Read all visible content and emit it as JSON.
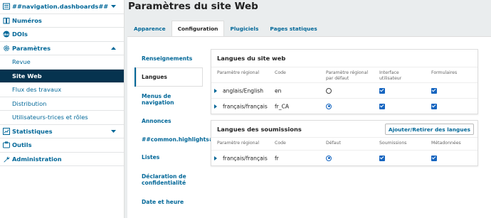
{
  "sidebar": {
    "dashboards": "##navigation.dashboards##",
    "numeros": "Numéros",
    "dois": "DOIs",
    "parametres": "Paramètres",
    "sub_items": [
      "Revue",
      "Site Web",
      "Flux des travaux",
      "Distribution",
      "Utilisateurs-trices et rôles"
    ],
    "statistiques": "Statistiques",
    "outils": "Outils",
    "administration": "Administration",
    "active_item": "Site Web"
  },
  "page": {
    "title": "Paramètres du site Web"
  },
  "tabs": [
    "Apparence",
    "Configuration",
    "Plugiciels",
    "Pages statiques"
  ],
  "active_tab": "Configuration",
  "subnav": [
    "Renseignements",
    "Langues",
    "Menus de navigation",
    "Annonces",
    "##common.highlights##",
    "Listes",
    "Déclaration de confidentialité",
    "Date et heure"
  ],
  "active_subnav": "Langues",
  "site_languages": {
    "title": "Langues du site web",
    "headers": [
      "Paramètre régional",
      "Code",
      "Paramètre régional par défaut",
      "Interface utilisateur",
      "Formulaires"
    ],
    "rows": [
      {
        "locale": "anglais/English",
        "code": "en",
        "default": false,
        "ui": true,
        "forms": true
      },
      {
        "locale": "français/français",
        "code": "fr_CA",
        "default": true,
        "ui": true,
        "forms": true
      }
    ]
  },
  "submission_languages": {
    "title": "Langues des soumissions",
    "action": "Ajouter/Retirer des langues",
    "headers": [
      "Paramètre régional",
      "Code",
      "Défaut",
      "Soumissions",
      "Métadonnées"
    ],
    "rows": [
      {
        "locale": "français/français",
        "code": "fr",
        "default": true,
        "submissions": true,
        "metadata": true
      }
    ]
  },
  "colors": {
    "link": "#006798",
    "active_nav": "#06334f",
    "control": "#1565c0"
  }
}
